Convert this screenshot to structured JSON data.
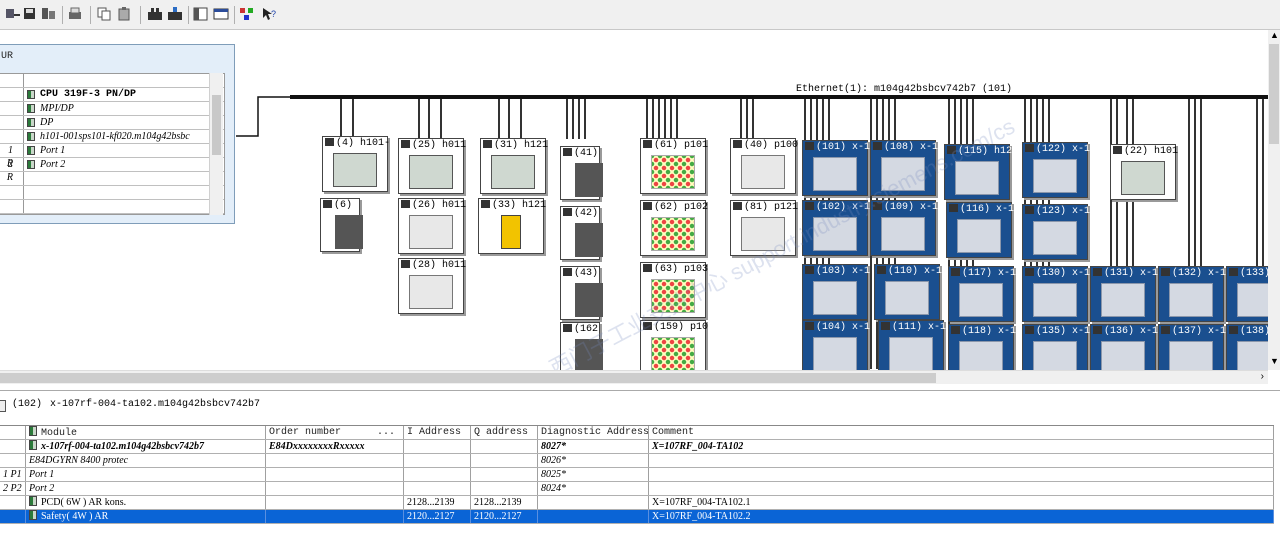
{
  "toolbar": {
    "icons": [
      "download-icon",
      "save-icon",
      "compile-icon",
      "print-icon",
      "copy-icon",
      "paste-icon",
      "accessible-nodes-icon",
      "upload-icon",
      "catalog-icon",
      "rack-icon",
      "network-icon",
      "help-icon"
    ]
  },
  "rack": {
    "title": "UR",
    "rows": [
      {
        "slot": "",
        "name": "",
        "bold": false
      },
      {
        "slot": "",
        "name": "CPU 319F-3 PN/DP",
        "bold": true
      },
      {
        "slot": "",
        "name": "MPI/DP",
        "bold": false
      },
      {
        "slot": "",
        "name": "DP",
        "bold": false
      },
      {
        "slot": "",
        "name": "h101-001sps101-kf020.m104g42bsbc",
        "bold": false
      },
      {
        "slot": "1 R",
        "name": "Port 1",
        "bold": false
      },
      {
        "slot": "2 R",
        "name": "Port 2",
        "bold": false
      },
      {
        "slot": "",
        "name": "",
        "bold": false
      },
      {
        "slot": "",
        "name": "",
        "bold": false
      },
      {
        "slot": "",
        "name": "",
        "bold": false
      }
    ]
  },
  "network": {
    "label": "Ethernet(1): m104g42bsbcv742b7 (101)",
    "watermark": "西门子工业支持中心 support.industry.siemens.com/cs"
  },
  "devices": [
    {
      "tag": "(4) h101-",
      "kind": "plc"
    },
    {
      "tag": "(6)",
      "kind": "io"
    },
    {
      "tag": "(25) h011",
      "kind": "plc"
    },
    {
      "tag": "(26) h011",
      "kind": "panel"
    },
    {
      "tag": "(28) h011",
      "kind": "panel"
    },
    {
      "tag": "(31) h121",
      "kind": "plc"
    },
    {
      "tag": "(33) h121",
      "kind": "yellow"
    },
    {
      "tag": "(41)",
      "kind": "io"
    },
    {
      "tag": "(42)",
      "kind": "io"
    },
    {
      "tag": "(43)",
      "kind": "io"
    },
    {
      "tag": "(162",
      "kind": "io"
    },
    {
      "tag": "(61) p101",
      "kind": "hmi"
    },
    {
      "tag": "(62) p102",
      "kind": "hmi"
    },
    {
      "tag": "(63) p103",
      "kind": "hmi"
    },
    {
      "tag": "(159) p10",
      "kind": "hmi"
    },
    {
      "tag": "(40) p100",
      "kind": "panel"
    },
    {
      "tag": "(81) p121",
      "kind": "panel"
    },
    {
      "tag": "(101) x-1",
      "kind": "blue"
    },
    {
      "tag": "(102) x-1",
      "kind": "blue"
    },
    {
      "tag": "(103) x-1",
      "kind": "blue"
    },
    {
      "tag": "(104) x-1",
      "kind": "blue"
    },
    {
      "tag": "(108) x-1",
      "kind": "blue"
    },
    {
      "tag": "(109) x-1",
      "kind": "blue"
    },
    {
      "tag": "(110) x-1",
      "kind": "blue"
    },
    {
      "tag": "(111) x-1",
      "kind": "blue"
    },
    {
      "tag": "(115) h12",
      "kind": "blue"
    },
    {
      "tag": "(116) x-1",
      "kind": "blue"
    },
    {
      "tag": "(117) x-1",
      "kind": "blue"
    },
    {
      "tag": "(118) x-1",
      "kind": "blue"
    },
    {
      "tag": "(122) x-1",
      "kind": "blue"
    },
    {
      "tag": "(123) x-1",
      "kind": "blue"
    },
    {
      "tag": "(130) x-1",
      "kind": "blue"
    },
    {
      "tag": "(135) x-1",
      "kind": "blue"
    },
    {
      "tag": "(22) h101",
      "kind": "plc"
    },
    {
      "tag": "(131) x-1",
      "kind": "blue"
    },
    {
      "tag": "(136) x-1",
      "kind": "blue"
    },
    {
      "tag": "(132) x-1",
      "kind": "blue"
    },
    {
      "tag": "(137) x-1",
      "kind": "blue"
    },
    {
      "tag": "(133)",
      "kind": "blue"
    },
    {
      "tag": "(138)",
      "kind": "blue"
    }
  ],
  "detail": {
    "number": "(102)",
    "name": "x-107rf-004-ta102.m104g42bsbcv742b7",
    "columns": [
      "Module",
      "Order number",
      "...",
      "I Address",
      "Q address",
      "Diagnostic Address",
      "Comment"
    ],
    "rows": [
      {
        "slot": "",
        "module": "x-107rf-004-ta102.m104g42bsbcv742b7",
        "order": "E84DxxxxxxxxRxxxxx",
        "i": "",
        "q": "",
        "diag": "8027*",
        "comment": "X=107RF_004-TA102",
        "style": "bolditalic",
        "icon": true,
        "selected": false
      },
      {
        "slot": "",
        "module": "E84DGYRN 8400 protec",
        "order": "",
        "i": "",
        "q": "",
        "diag": "8026*",
        "comment": "",
        "style": "italic",
        "icon": false,
        "selected": false
      },
      {
        "slot": "1 P1",
        "module": "Port 1",
        "order": "",
        "i": "",
        "q": "",
        "diag": "8025*",
        "comment": "",
        "style": "italic",
        "icon": false,
        "selected": false
      },
      {
        "slot": "2 P2",
        "module": "Port 2",
        "order": "",
        "i": "",
        "q": "",
        "diag": "8024*",
        "comment": "",
        "style": "italic",
        "icon": false,
        "selected": false
      },
      {
        "slot": "",
        "module": "PCD( 6W ) AR kons.",
        "order": "",
        "i": "2128...2139",
        "q": "2128...2139",
        "diag": "",
        "comment": "X=107RF_004-TA102.1",
        "style": "normal",
        "icon": true,
        "selected": false
      },
      {
        "slot": "",
        "module": "Safety( 4W ) AR",
        "order": "",
        "i": "2120...2127",
        "q": "2120...2127",
        "diag": "",
        "comment": "X=107RF_004-TA102.2",
        "style": "normal",
        "icon": true,
        "selected": true
      }
    ]
  }
}
